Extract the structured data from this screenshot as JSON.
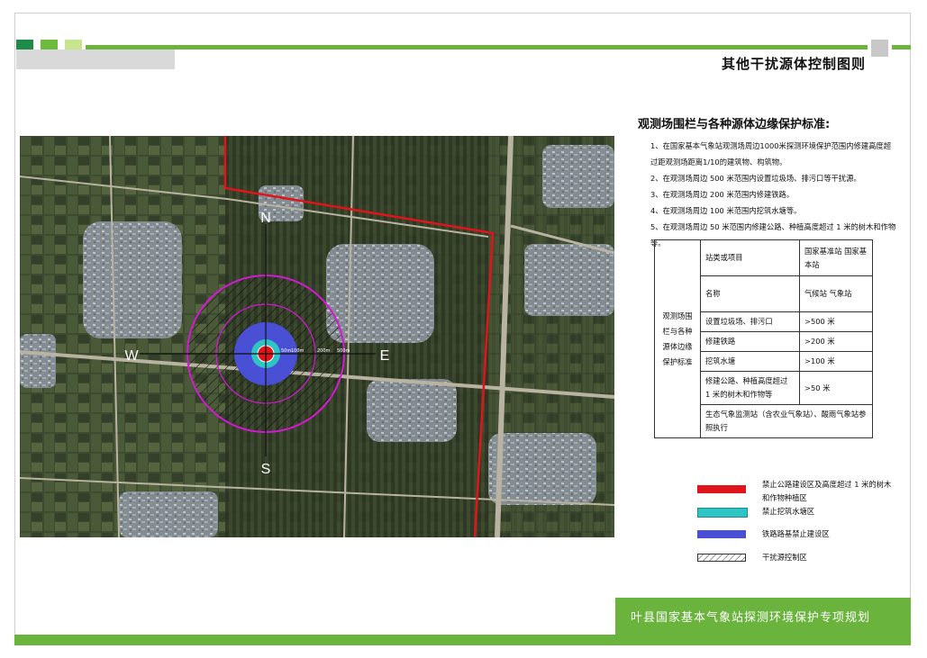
{
  "header": {
    "title": "其他干扰源体控制图则",
    "accent_colors": [
      "#1e8b4b",
      "#6dbb3c",
      "#c8e58e"
    ]
  },
  "map": {
    "compass": {
      "north": "N",
      "south": "S",
      "east": "E",
      "west": "W"
    },
    "ring_labels": [
      "50m",
      "100m",
      "200m",
      "500m"
    ]
  },
  "standards": {
    "title": "观测场围栏与各种源体边缘保护标准:",
    "items": [
      "1、在国家基本气象站观测场周边1000米探测环境保护范围内修建高度超过距观测场距离1/10的建筑物、构筑物。",
      "2、在观测场周边 500 米范围内设置垃圾场、排污口等干扰源。",
      "3、在观测场周边 200 米范围内修建铁路。",
      "4、在观测场周边 100 米范围内挖筑水塘等。",
      "5、在观测场周边 50 米范围内修建公路、种植高度超过 1 米的树木和作物等。"
    ]
  },
  "table": {
    "side_label": "观测场围栏与各种源体边缘保护标准",
    "header": {
      "item": "站类或项目",
      "value": "国家基准站 国家基本站"
    },
    "rows": [
      {
        "item": "名称",
        "value": "气候站 气象站"
      },
      {
        "item": "设置垃圾场、排污口",
        "value": ">500 米"
      },
      {
        "item": "修建铁路",
        "value": ">200 米"
      },
      {
        "item": "挖筑水塘",
        "value": ">100 米"
      },
      {
        "item": "修建公路、种植高度超过 1 米的树木和作物等",
        "value": ">50 米"
      }
    ],
    "note": "生态气象监测站（含农业气象站）、酸雨气象站参照执行"
  },
  "legend": [
    {
      "label": "禁止公路建设区及高度超过 1 米的树木和作物种植区",
      "color": "#e0141b",
      "icon": "solid"
    },
    {
      "label": "禁止挖筑水塘区",
      "color": "#2fc4c4",
      "icon": "solid"
    },
    {
      "label": "铁路路基禁止建设区",
      "color": "#4a50d6",
      "icon": "solid"
    },
    {
      "label": "干扰源控制区",
      "color": "#333333",
      "icon": "hatch"
    }
  ],
  "footer": {
    "text": "叶县国家基本气象站探测环境保护专项规划"
  }
}
